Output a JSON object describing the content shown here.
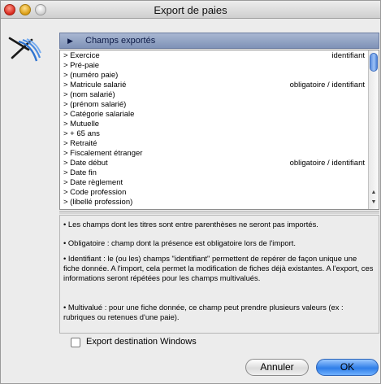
{
  "window": {
    "title": "Export de paies"
  },
  "section": {
    "header": "Champs exportés"
  },
  "fields": [
    {
      "name": "> Exercice",
      "status": "identifiant"
    },
    {
      "name": "> Pré-paie",
      "status": ""
    },
    {
      "name": "> (numéro paie)",
      "status": ""
    },
    {
      "name": "> Matricule salarié",
      "status": "obligatoire / identifiant"
    },
    {
      "name": "> (nom salarié)",
      "status": ""
    },
    {
      "name": "> (prénom salarié)",
      "status": ""
    },
    {
      "name": "> Catégorie salariale",
      "status": ""
    },
    {
      "name": "> Mutuelle",
      "status": ""
    },
    {
      "name": "> + 65 ans",
      "status": ""
    },
    {
      "name": "> Retraité",
      "status": ""
    },
    {
      "name": "> Fiscalement étranger",
      "status": ""
    },
    {
      "name": "> Date début",
      "status": "obligatoire / identifiant"
    },
    {
      "name": "> Date fin",
      "status": ""
    },
    {
      "name": "> Date règlement",
      "status": ""
    },
    {
      "name": "> Code profession",
      "status": ""
    },
    {
      "name": "> (libellé profession)",
      "status": ""
    }
  ],
  "notes": {
    "n1": "• Les champs dont les titres sont entre parenthèses ne seront pas importés.",
    "n2": "• Obligatoire : champ dont la présence est obligatoire lors de l'import.",
    "n3": "• Identifiant : le (ou les) champs \"identifiant\" permettent de repérer de façon unique une fiche donnée. A l'import, cela permet la modification de fiches déjà existantes. A l'export, ces informations seront répétées pour les champs multivalués.",
    "n4": "• Multivalué : pour une fiche donnée, ce champ peut prendre plusieurs valeurs (ex : rubriques ou retenues d'une paie)."
  },
  "options": {
    "export_windows_label": "Export destination Windows",
    "export_windows_checked": false
  },
  "buttons": {
    "cancel": "Annuler",
    "ok": "OK"
  },
  "colors": {
    "header_bg": "#8fa0c4",
    "ok_button": "#3a86ee",
    "window_bg": "#ececec"
  }
}
